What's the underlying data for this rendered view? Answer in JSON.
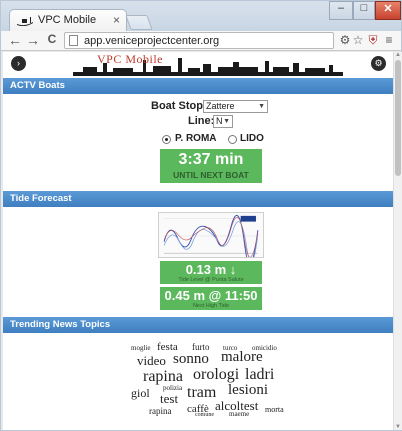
{
  "browser": {
    "tab_title": "VPC Mobile",
    "tab_close": "×",
    "url": "app.veniceprojectcenter.org",
    "window_controls": {
      "minimize": "–",
      "maximize": "□",
      "close": "✕"
    },
    "nav": {
      "back": "←",
      "forward": "→",
      "reload": "C"
    },
    "toolbar_icons": {
      "settings": "⚙",
      "bookmark": "☆",
      "ext": "⛨",
      "menu": "≡"
    }
  },
  "site": {
    "logo_text": "VPC Mobile",
    "left_button": "›",
    "right_button": "⚙"
  },
  "actv": {
    "section_title": "ACTV Boats",
    "boat_stop_label": "Boat Stop:",
    "boat_stop_value": "Zattere",
    "line_label": "Line:",
    "line_value": "N",
    "direction_options": [
      {
        "label": "P. ROMA",
        "selected": true
      },
      {
        "label": "LIDO",
        "selected": false
      }
    ],
    "countdown_value": "3:37 min",
    "countdown_caption": "UNTIL NEXT BOAT"
  },
  "tide": {
    "section_title": "Tide Forecast",
    "level_value": "0.13 m ↓",
    "level_caption": "Tide Level @ Punta Salute",
    "high_tide_value": "0.45 m @ 11:50",
    "high_tide_caption": "Next High Tide"
  },
  "news": {
    "section_title": "Trending News Topics",
    "words": [
      "moglie",
      "festa",
      "furto",
      "turco",
      "omicidio",
      "video",
      "sonno",
      "malore",
      "rapina",
      "orologi",
      "ladri",
      "giol",
      "polizia",
      "tram",
      "lesioni",
      "test",
      "alcoltest",
      "rapina",
      "caffè",
      "comune",
      "maeme",
      "morta"
    ]
  },
  "colors": {
    "section_bar": "#4a8bcb",
    "green": "#5cb85c",
    "logo": "#c0392b"
  }
}
